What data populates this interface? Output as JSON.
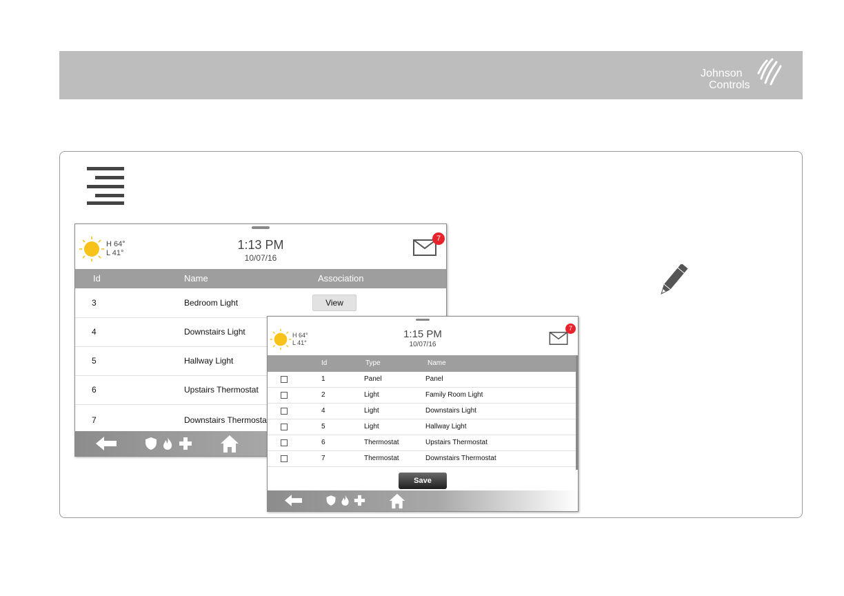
{
  "brand": {
    "line1": "Johnson",
    "line2": "Controls"
  },
  "screen1": {
    "weather": {
      "high": "H 64°",
      "low": "L 41°"
    },
    "time": "1:13 PM",
    "date": "10/07/16",
    "mail_count": "7",
    "columns": [
      "Id",
      "Name",
      "Association"
    ],
    "view_label": "View",
    "rows": [
      {
        "id": "3",
        "name": "Bedroom Light",
        "has_view": true
      },
      {
        "id": "4",
        "name": "Downstairs Light"
      },
      {
        "id": "5",
        "name": "Hallway Light"
      },
      {
        "id": "6",
        "name": "Upstairs Thermostat"
      },
      {
        "id": "7",
        "name": "Downstairs Thermostat"
      }
    ]
  },
  "screen2": {
    "weather": {
      "high": "H 64°",
      "low": "L 41°"
    },
    "time": "1:15 PM",
    "date": "10/07/16",
    "mail_count": "7",
    "columns": [
      "Id",
      "Type",
      "Name"
    ],
    "rows": [
      {
        "id": "1",
        "type": "Panel",
        "name": "Panel"
      },
      {
        "id": "2",
        "type": "Light",
        "name": "Family Room Light"
      },
      {
        "id": "4",
        "type": "Light",
        "name": "Downstairs Light"
      },
      {
        "id": "5",
        "type": "Light",
        "name": "Hallway Light"
      },
      {
        "id": "6",
        "type": "Thermostat",
        "name": "Upstairs Thermostat"
      },
      {
        "id": "7",
        "type": "Thermostat",
        "name": "Downstairs Thermostat"
      }
    ],
    "save_label": "Save"
  },
  "icons": [
    "menu-icon",
    "pencil-icon",
    "sun-icon",
    "mail-icon",
    "back-arrow-icon",
    "shield-icon",
    "flame-icon",
    "medical-cross-icon",
    "home-icon"
  ],
  "colors": {
    "banner": "#bdbdbd",
    "table_header": "#9e9e9e",
    "badge": "#e8222b",
    "sun": "#f7c21a"
  }
}
